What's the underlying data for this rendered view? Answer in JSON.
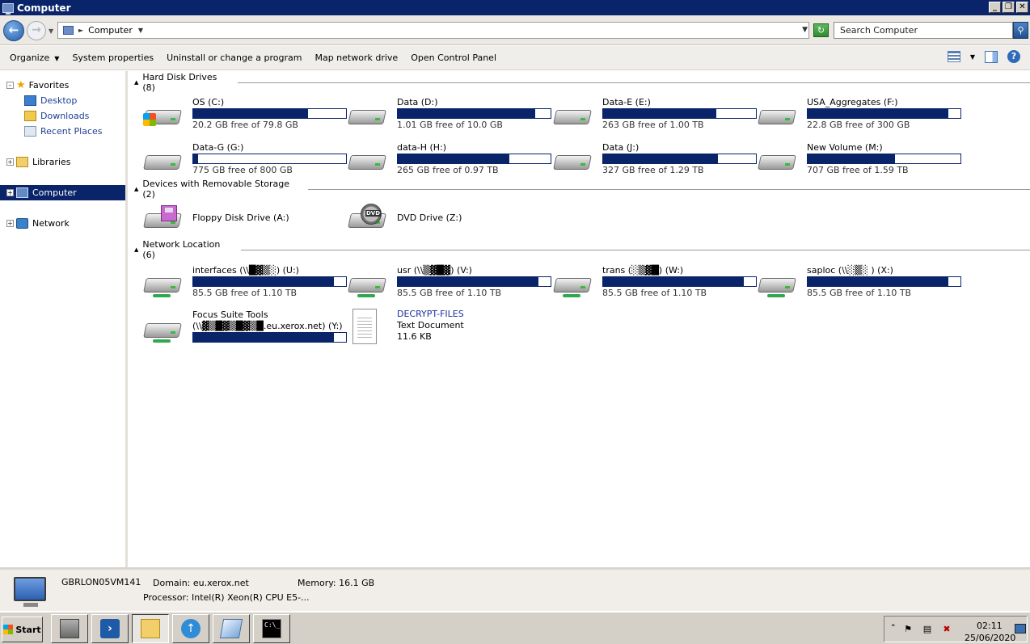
{
  "window": {
    "title": "Computer"
  },
  "window_buttons": [
    "_",
    "❐",
    "✕"
  ],
  "address": {
    "path": "Computer",
    "search_placeholder": "Search Computer"
  },
  "commands": [
    "Organize",
    "System properties",
    "Uninstall or change a program",
    "Map network drive",
    "Open Control Panel"
  ],
  "sidebar": {
    "favorites": "Favorites",
    "favorites_items": [
      "Desktop",
      "Downloads",
      "Recent Places"
    ],
    "libraries": "Libraries",
    "computer": "Computer",
    "network": "Network"
  },
  "groups": {
    "hard_disks": "Hard Disk Drives (8)",
    "removable": "Devices with Removable Storage (2)",
    "network": "Network Location (6)"
  },
  "hard_disks": [
    {
      "name": "OS (C:)",
      "free": "20.2 GB free of 79.8 GB",
      "used_fraction": 0.75
    },
    {
      "name": "Data (D:)",
      "free": "1.01 GB free of 10.0 GB",
      "used_fraction": 0.9
    },
    {
      "name": "Data-E (E:)",
      "free": "263 GB free of 1.00 TB",
      "used_fraction": 0.74
    },
    {
      "name": "USA_Aggregates (F:)",
      "free": "22.8 GB free of 300 GB",
      "used_fraction": 0.92
    },
    {
      "name": "Data-G (G:)",
      "free": "775 GB free of 800 GB",
      "used_fraction": 0.03
    },
    {
      "name": "data-H (H:)",
      "free": "265 GB free of 0.97 TB",
      "used_fraction": 0.73
    },
    {
      "name": "Data (J:)",
      "free": "327 GB free of 1.29 TB",
      "used_fraction": 0.75
    },
    {
      "name": "New Volume (M:)",
      "free": "707 GB free of 1.59 TB",
      "used_fraction": 0.57
    }
  ],
  "removable": [
    {
      "name": "Floppy Disk Drive (A:)",
      "icon": "floppy-icon"
    },
    {
      "name": "DVD Drive (Z:)",
      "icon": "dvd-icon"
    }
  ],
  "network_locations": [
    {
      "name": "interfaces (\\\\█▓▒░) (U:)",
      "free": "85.5 GB free of 1.10 TB",
      "used_fraction": 0.92
    },
    {
      "name": "usr (\\\\▒▓█▓) (V:)",
      "free": "85.5 GB free of 1.10 TB",
      "used_fraction": 0.92
    },
    {
      "name": "trans (░▒▓█) (W:)",
      "free": "85.5 GB free of 1.10 TB",
      "used_fraction": 0.92
    },
    {
      "name": "saploc (\\\\░▒░ ) (X:)",
      "free": "85.5 GB free of 1.10 TB",
      "used_fraction": 0.92
    }
  ],
  "focus_suite": {
    "name": "Focus Suite Tools",
    "path": "(\\\\▓▒█▓▒█▓▒█.eu.xerox.net) (Y:)",
    "used_fraction": 0.92
  },
  "decrypt_file": {
    "name": "DECRYPT-FILES",
    "type": "Text Document",
    "size": "11.6 KB"
  },
  "details": {
    "computer_name": "GBRLON05VM141",
    "domain": "Domain: eu.xerox.net",
    "memory": "Memory: 16.1 GB",
    "processor": "Processor: Intel(R) Xeon(R) CPU E5-..."
  },
  "taskbar": {
    "start": "Start",
    "cmd_label": "C:\\_"
  },
  "clock": {
    "time": "02:11",
    "date": "25/06/2020"
  },
  "colors": {
    "titlebar": "#0a246a",
    "progress": "#0a246a",
    "selection": "#0a246a"
  }
}
